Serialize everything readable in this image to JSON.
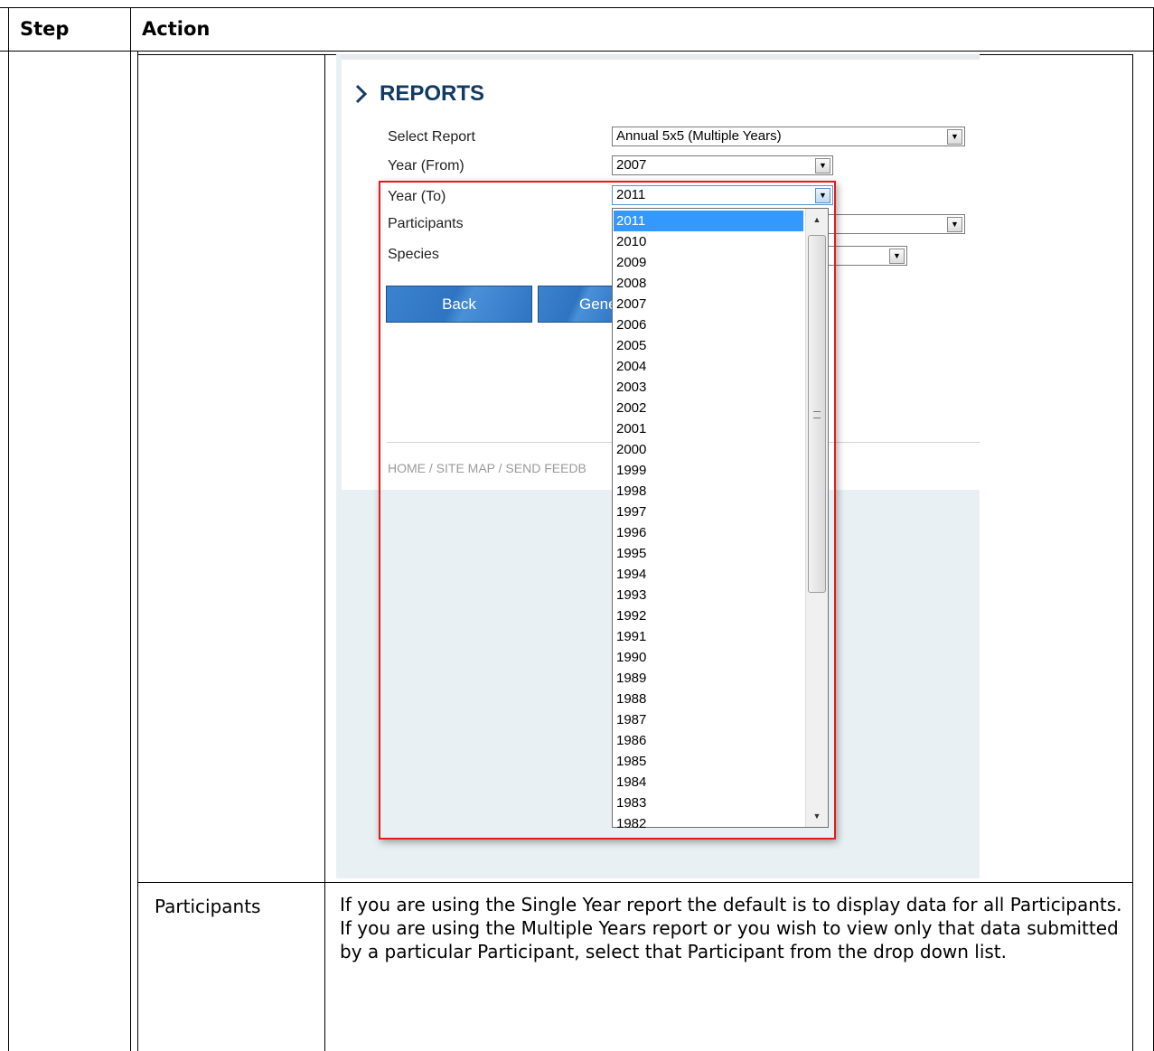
{
  "table": {
    "col_step": "Step",
    "col_action": "Action"
  },
  "screenshot": {
    "heading": "REPORTS",
    "fields": {
      "select_report": {
        "label": "Select Report",
        "value": "Annual 5x5 (Multiple Years)"
      },
      "year_from": {
        "label": "Year (From)",
        "value": "2007"
      },
      "year_to": {
        "label": "Year (To)",
        "value": "2011"
      },
      "participants": {
        "label": "Participants"
      },
      "species": {
        "label": "Species"
      }
    },
    "buttons": {
      "back": "Back",
      "generate": "Gene"
    },
    "footer_links": "HOME / SITE MAP  / SEND FEEDB",
    "dropdown_years": [
      "2011",
      "2010",
      "2009",
      "2008",
      "2007",
      "2006",
      "2005",
      "2004",
      "2003",
      "2002",
      "2001",
      "2000",
      "1999",
      "1998",
      "1997",
      "1996",
      "1995",
      "1994",
      "1993",
      "1992",
      "1991",
      "1990",
      "1989",
      "1988",
      "1987",
      "1986",
      "1985",
      "1984",
      "1983",
      "1982"
    ],
    "highlight_color": "#e21b1b"
  },
  "row2": {
    "name": "Participants",
    "description": "If you are using the Single Year report the default is to display data for all Participants. If you are using the Multiple Years report or you wish to view only that data submitted by a particular Participant, select that Participant from the drop down list."
  }
}
